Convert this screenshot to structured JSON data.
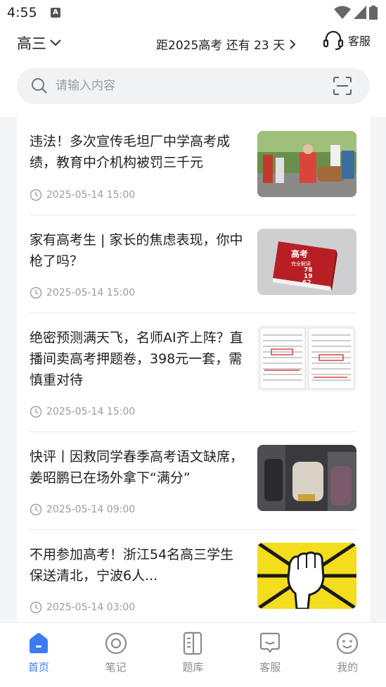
{
  "status_bar": {
    "time": "4:55",
    "badge": "A"
  },
  "header": {
    "grade": "高三",
    "countdown": "距2025高考 还有 23 天",
    "service_label": "客服"
  },
  "search": {
    "placeholder": "请输入内容"
  },
  "news": [
    {
      "title": "违法！多次宣传毛坦厂中学高考成绩，教育中介机构被罚三千元",
      "time": "2025-05-14 15:00"
    },
    {
      "title": "家有高考生 | 家长的焦虑表现，你中枪了吗？",
      "time": "2025-05-14 15:00"
    },
    {
      "title": "绝密预测满天飞，名师AI齐上阵？直播间卖高考押题卷，398元一套，需慎重对待",
      "time": "2025-05-14 15:00"
    },
    {
      "title": "快评丨因救同学春季高考语文缺席，姜昭鹏已在场外拿下“满分”",
      "time": "2025-05-14 09:00"
    },
    {
      "title": "不用参加高考！浙江54名高三学生保送清北，宁波6人...",
      "time": "2025-05-14 03:00"
    }
  ],
  "thumb_text": {
    "book_title": "高考",
    "book_subtitle": "完全解读",
    "book_nums": [
      "78",
      "19",
      "62"
    ]
  },
  "bottom_nav": [
    {
      "label": "首页",
      "icon": "home-icon",
      "active": true
    },
    {
      "label": "笔记",
      "icon": "notes-icon",
      "active": false
    },
    {
      "label": "题库",
      "icon": "question-bank-icon",
      "active": false
    },
    {
      "label": "客服",
      "icon": "chat-icon",
      "active": false
    },
    {
      "label": "我的",
      "icon": "smile-icon",
      "active": false
    }
  ],
  "colors": {
    "accent": "#3b7cf5",
    "background": "#f4f5f7",
    "muted": "#9a9ca2"
  }
}
